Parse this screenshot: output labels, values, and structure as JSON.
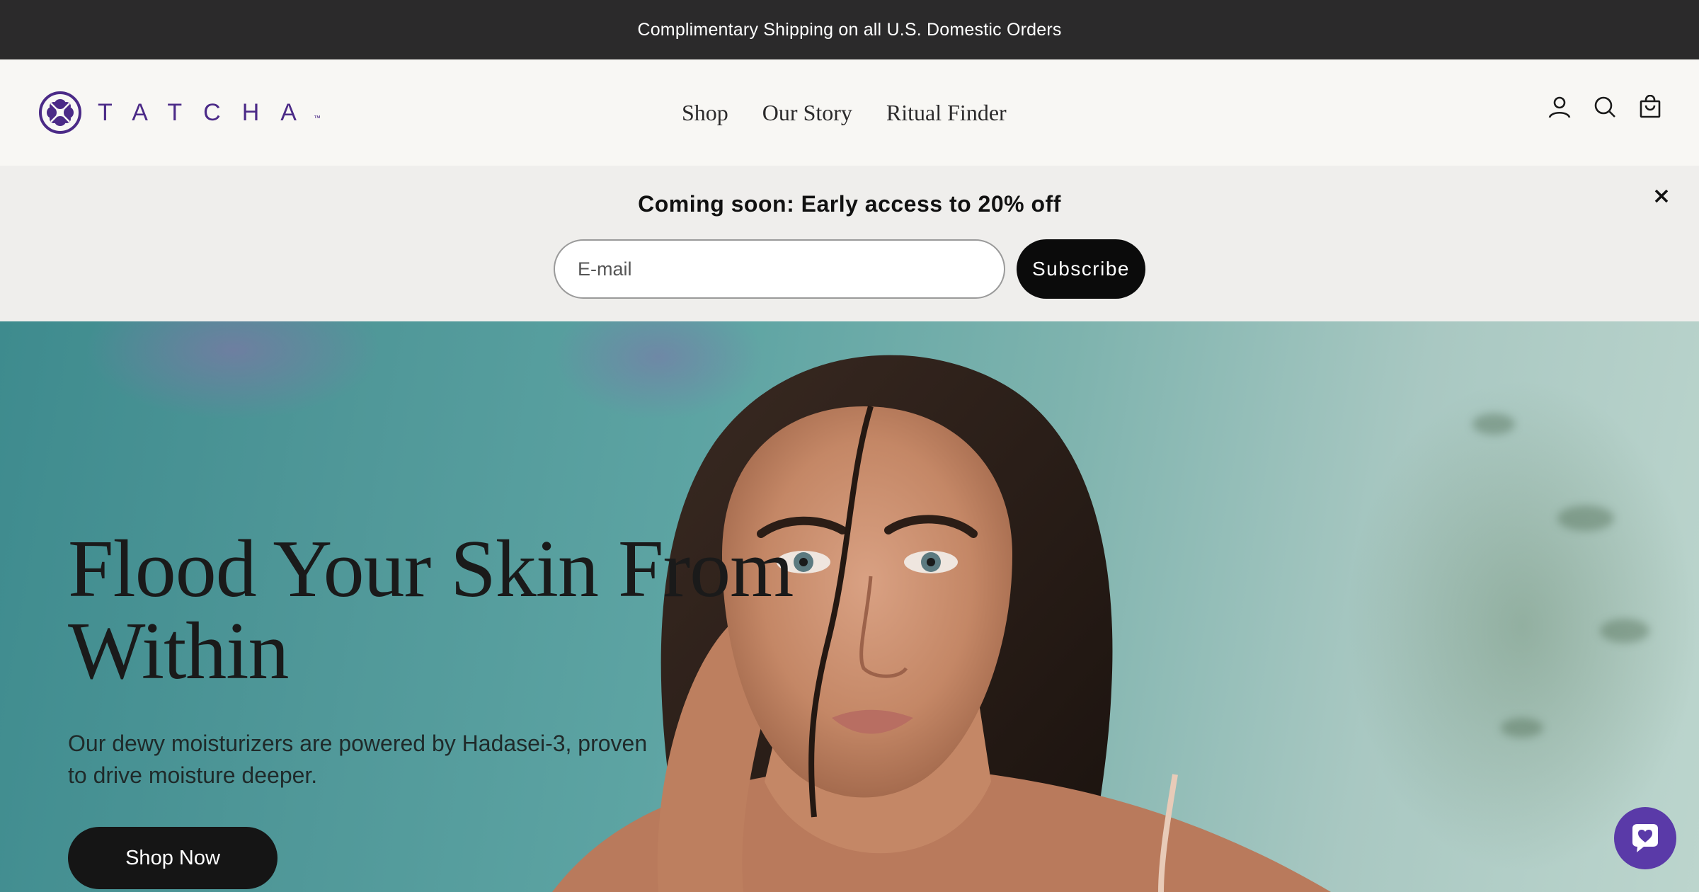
{
  "announcement": {
    "text": "Complimentary Shipping on all U.S. Domestic Orders"
  },
  "header": {
    "logo_text": "TATCHA",
    "logo_tm": "™",
    "nav": [
      {
        "label": "Shop"
      },
      {
        "label": "Our Story"
      },
      {
        "label": "Ritual Finder"
      }
    ],
    "icons": [
      "account-icon",
      "search-icon",
      "cart-icon"
    ]
  },
  "promo": {
    "title": "Coming soon: Early access to 20% off",
    "email_placeholder": "E-mail",
    "subscribe_label": "Subscribe",
    "close_icon": "close-icon"
  },
  "hero": {
    "title_line1": "Flood Your Skin From",
    "title_line2": "Within",
    "subtitle_line1": "Our dewy moisturizers are powered by Hadasei-3, proven",
    "subtitle_line2": "to drive moisture deeper.",
    "cta_label": "Shop Now"
  },
  "chat": {
    "icon": "chat-heart-icon"
  },
  "colors": {
    "brand_purple": "#4b2a87",
    "announcement_bg": "#2b2a2b",
    "header_bg": "#f8f7f4",
    "promo_bg": "#efeeec",
    "button_dark": "#0b0b0b",
    "chat_purple": "#5a3aa8"
  }
}
